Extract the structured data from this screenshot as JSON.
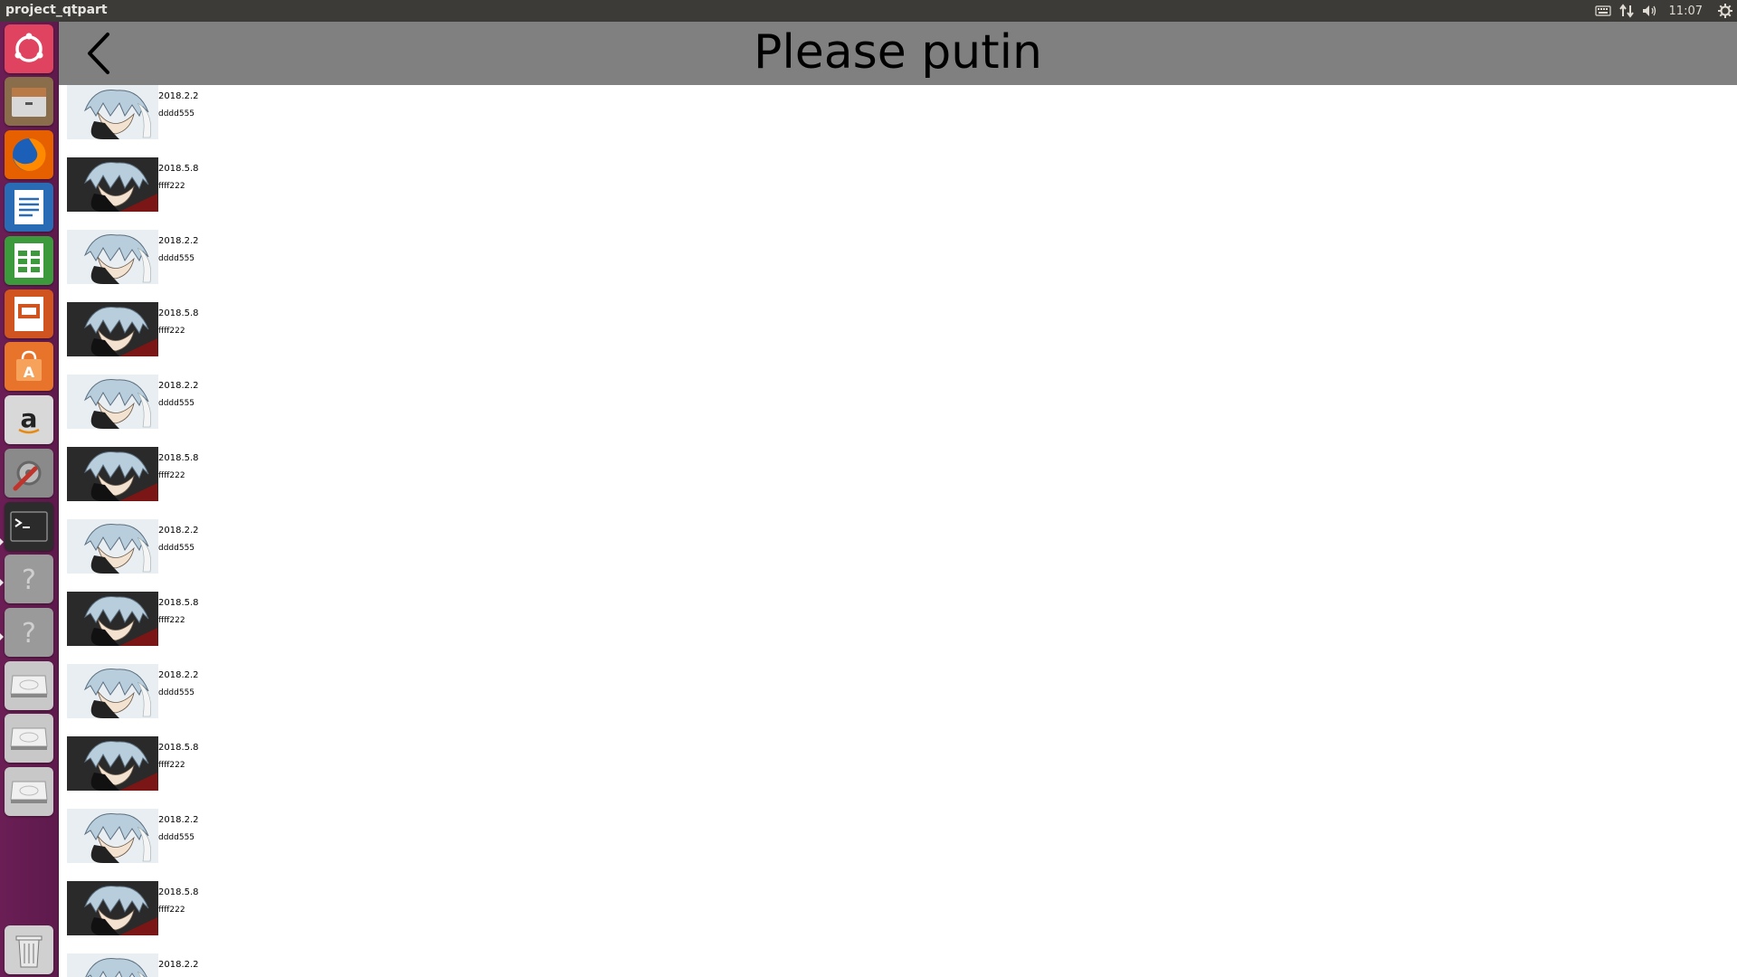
{
  "top_panel": {
    "app_title": "project_qtpart",
    "clock": "11:07",
    "tray_icons": [
      "keyboard-icon",
      "network-icon",
      "volume-icon",
      "gear-icon"
    ]
  },
  "launcher": {
    "items": [
      {
        "name": "ubuntu-dash-icon",
        "color": "#e0435f"
      },
      {
        "name": "files-icon",
        "color": "#8a6d4a"
      },
      {
        "name": "firefox-icon",
        "color": "#e66000"
      },
      {
        "name": "writer-icon",
        "color": "#2a6bb5"
      },
      {
        "name": "calc-icon",
        "color": "#3c9a3c"
      },
      {
        "name": "impress-icon",
        "color": "#d0541f"
      },
      {
        "name": "software-center-icon",
        "color": "#e8742b"
      },
      {
        "name": "amazon-icon",
        "color": "#d8d8d8"
      },
      {
        "name": "system-settings-icon",
        "color": "#8a8a8a"
      },
      {
        "name": "terminal-icon",
        "color": "#2c2c2c"
      },
      {
        "name": "unknown-app-icon",
        "color": "#9a9a9a"
      },
      {
        "name": "unknown-app-icon",
        "color": "#9a9a9a"
      },
      {
        "name": "drive-icon",
        "color": "#c8c8c8"
      },
      {
        "name": "drive-icon",
        "color": "#c8c8c8"
      },
      {
        "name": "drive-icon",
        "color": "#c8c8c8"
      },
      {
        "name": "trash-icon",
        "color": "#d0d0d0"
      }
    ]
  },
  "header": {
    "title": "Please putin",
    "back_icon": "chevron-left-icon"
  },
  "list": {
    "items": [
      {
        "date": "2018.2.2",
        "text": "dddd555",
        "thumb": "light"
      },
      {
        "date": "2018.5.8",
        "text": "ffff222",
        "thumb": "dark"
      },
      {
        "date": "2018.2.2",
        "text": "dddd555",
        "thumb": "light"
      },
      {
        "date": "2018.5.8",
        "text": "ffff222",
        "thumb": "dark"
      },
      {
        "date": "2018.2.2",
        "text": "dddd555",
        "thumb": "light"
      },
      {
        "date": "2018.5.8",
        "text": "ffff222",
        "thumb": "dark"
      },
      {
        "date": "2018.2.2",
        "text": "dddd555",
        "thumb": "light"
      },
      {
        "date": "2018.5.8",
        "text": "ffff222",
        "thumb": "dark"
      },
      {
        "date": "2018.2.2",
        "text": "dddd555",
        "thumb": "light"
      },
      {
        "date": "2018.5.8",
        "text": "ffff222",
        "thumb": "dark"
      },
      {
        "date": "2018.2.2",
        "text": "dddd555",
        "thumb": "light"
      },
      {
        "date": "2018.5.8",
        "text": "ffff222",
        "thumb": "dark"
      },
      {
        "date": "2018.2.2",
        "text": "",
        "thumb": "light"
      }
    ]
  }
}
